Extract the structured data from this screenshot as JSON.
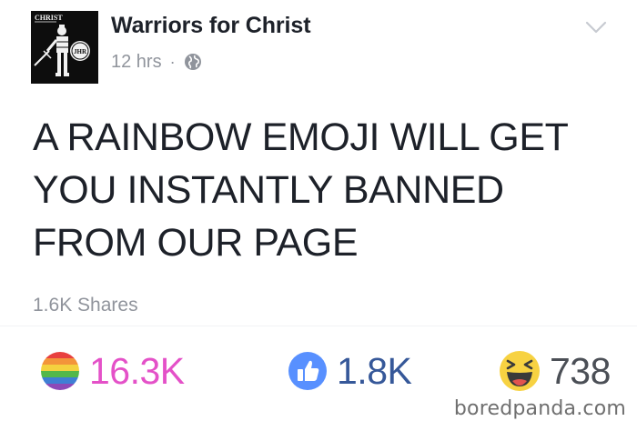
{
  "post": {
    "page_name": "Warriors for Christ",
    "time": "12 hrs",
    "separator": "·",
    "privacy_icon": "globe-icon",
    "menu_icon": "chevron-down-icon",
    "avatar": {
      "logo_text": "CHRIST",
      "shield_text": "JHR",
      "colors": {
        "background": "#0d0d0d",
        "figure": "#f2f2f2"
      }
    },
    "text": "A RAINBOW EMOJI WILL GET YOU INSTANTLY BANNED FROM OUR PAGE",
    "shares": "1.6K Shares"
  },
  "reactions": [
    {
      "icon": "rainbow-icon",
      "count": "16.3K",
      "color": "#e451c8"
    },
    {
      "icon": "like-icon",
      "count": "1.8K",
      "color": "#365899"
    },
    {
      "icon": "haha-icon",
      "count": "738",
      "color": "#4b4f56"
    }
  ],
  "watermark": "boredpanda.com",
  "colors": {
    "name_text": "#1d2129",
    "meta_text": "#90949c",
    "like_blue": "#5890ff",
    "haha_yellow": "#f7d242"
  }
}
